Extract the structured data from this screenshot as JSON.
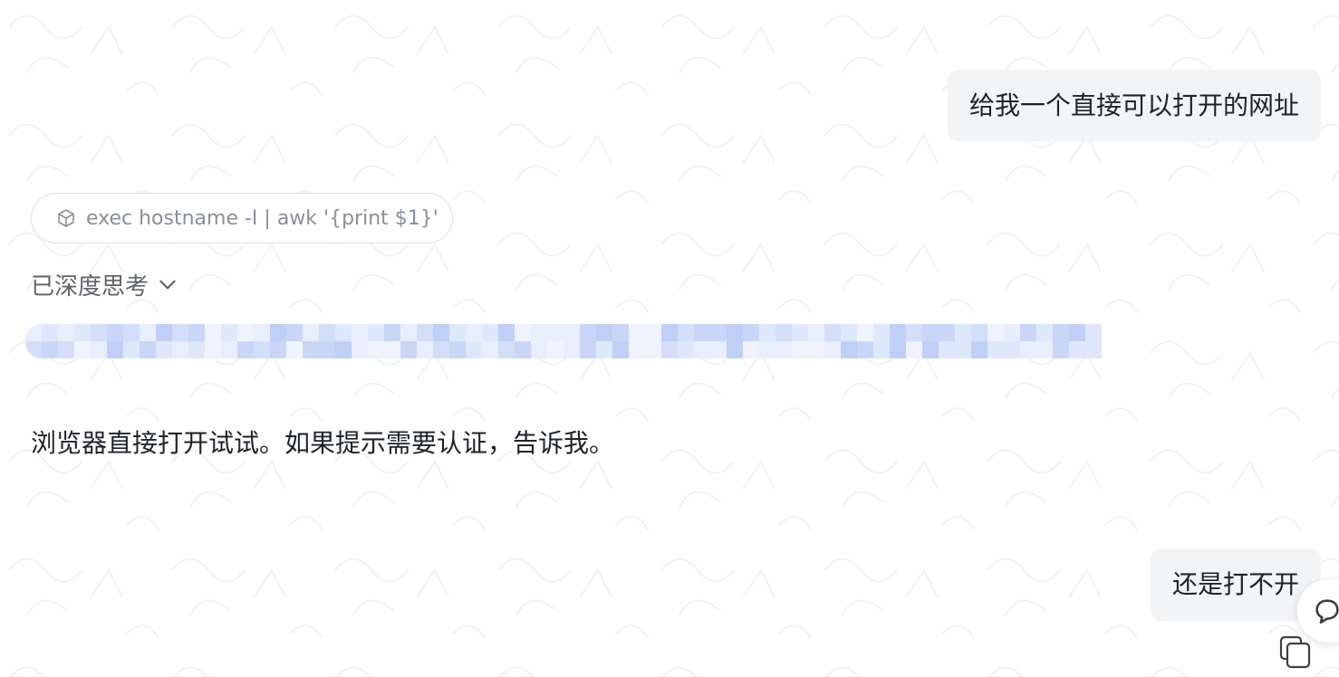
{
  "messages": {
    "user_1": "给我一个直接可以打开的网址",
    "tool_call": "exec hostname -I | awk '{print $1}'",
    "thinking_label": "已深度思考",
    "assistant_1": "浏览器直接打开试试。如果提示需要认证，告诉我。",
    "user_2": "还是打不开"
  },
  "icons": {
    "tool": "cube-icon",
    "thinking_toggle": "chevron-down-icon",
    "feedback": "chat-bubble-icon",
    "copy": "copy-icon"
  },
  "colors": {
    "user_bubble_bg": "#f3f4f6",
    "text_primary": "#1f2329",
    "text_muted": "#8a8f99",
    "redaction": "#c9d6f7"
  }
}
